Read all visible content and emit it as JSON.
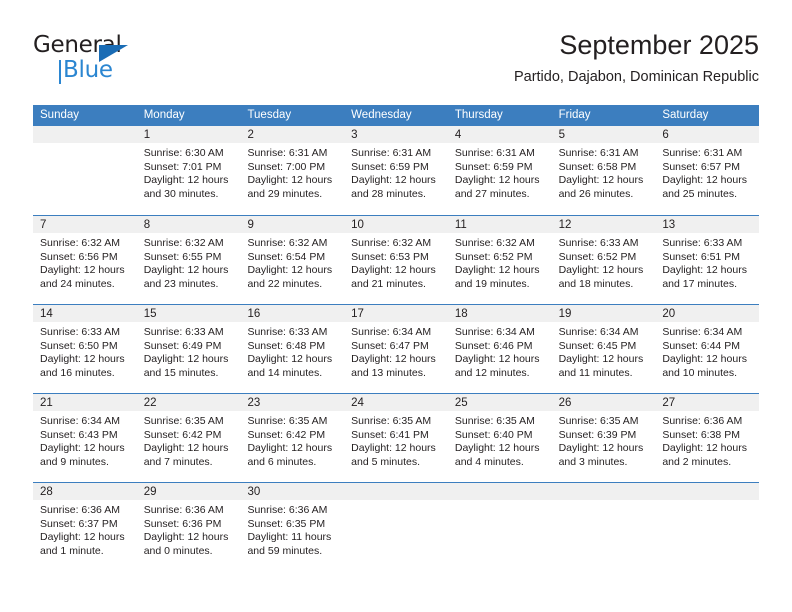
{
  "brand": {
    "name_part1": "General",
    "name_part2": "Blue",
    "accent_color": "#2b86d1",
    "triangle_color": "#1a6cb5"
  },
  "header": {
    "title": "September 2025",
    "subtitle": "Partido, Dajabon, Dominican Republic"
  },
  "calendar": {
    "header_color": "#3c7ebf",
    "daynum_band_color": "#f0f0f0",
    "weekdays": [
      "Sunday",
      "Monday",
      "Tuesday",
      "Wednesday",
      "Thursday",
      "Friday",
      "Saturday"
    ],
    "weeks": [
      [
        {
          "day": "",
          "lines": []
        },
        {
          "day": "1",
          "lines": [
            "Sunrise: 6:30 AM",
            "Sunset: 7:01 PM",
            "Daylight: 12 hours",
            "and 30 minutes."
          ]
        },
        {
          "day": "2",
          "lines": [
            "Sunrise: 6:31 AM",
            "Sunset: 7:00 PM",
            "Daylight: 12 hours",
            "and 29 minutes."
          ]
        },
        {
          "day": "3",
          "lines": [
            "Sunrise: 6:31 AM",
            "Sunset: 6:59 PM",
            "Daylight: 12 hours",
            "and 28 minutes."
          ]
        },
        {
          "day": "4",
          "lines": [
            "Sunrise: 6:31 AM",
            "Sunset: 6:59 PM",
            "Daylight: 12 hours",
            "and 27 minutes."
          ]
        },
        {
          "day": "5",
          "lines": [
            "Sunrise: 6:31 AM",
            "Sunset: 6:58 PM",
            "Daylight: 12 hours",
            "and 26 minutes."
          ]
        },
        {
          "day": "6",
          "lines": [
            "Sunrise: 6:31 AM",
            "Sunset: 6:57 PM",
            "Daylight: 12 hours",
            "and 25 minutes."
          ]
        }
      ],
      [
        {
          "day": "7",
          "lines": [
            "Sunrise: 6:32 AM",
            "Sunset: 6:56 PM",
            "Daylight: 12 hours",
            "and 24 minutes."
          ]
        },
        {
          "day": "8",
          "lines": [
            "Sunrise: 6:32 AM",
            "Sunset: 6:55 PM",
            "Daylight: 12 hours",
            "and 23 minutes."
          ]
        },
        {
          "day": "9",
          "lines": [
            "Sunrise: 6:32 AM",
            "Sunset: 6:54 PM",
            "Daylight: 12 hours",
            "and 22 minutes."
          ]
        },
        {
          "day": "10",
          "lines": [
            "Sunrise: 6:32 AM",
            "Sunset: 6:53 PM",
            "Daylight: 12 hours",
            "and 21 minutes."
          ]
        },
        {
          "day": "11",
          "lines": [
            "Sunrise: 6:32 AM",
            "Sunset: 6:52 PM",
            "Daylight: 12 hours",
            "and 19 minutes."
          ]
        },
        {
          "day": "12",
          "lines": [
            "Sunrise: 6:33 AM",
            "Sunset: 6:52 PM",
            "Daylight: 12 hours",
            "and 18 minutes."
          ]
        },
        {
          "day": "13",
          "lines": [
            "Sunrise: 6:33 AM",
            "Sunset: 6:51 PM",
            "Daylight: 12 hours",
            "and 17 minutes."
          ]
        }
      ],
      [
        {
          "day": "14",
          "lines": [
            "Sunrise: 6:33 AM",
            "Sunset: 6:50 PM",
            "Daylight: 12 hours",
            "and 16 minutes."
          ]
        },
        {
          "day": "15",
          "lines": [
            "Sunrise: 6:33 AM",
            "Sunset: 6:49 PM",
            "Daylight: 12 hours",
            "and 15 minutes."
          ]
        },
        {
          "day": "16",
          "lines": [
            "Sunrise: 6:33 AM",
            "Sunset: 6:48 PM",
            "Daylight: 12 hours",
            "and 14 minutes."
          ]
        },
        {
          "day": "17",
          "lines": [
            "Sunrise: 6:34 AM",
            "Sunset: 6:47 PM",
            "Daylight: 12 hours",
            "and 13 minutes."
          ]
        },
        {
          "day": "18",
          "lines": [
            "Sunrise: 6:34 AM",
            "Sunset: 6:46 PM",
            "Daylight: 12 hours",
            "and 12 minutes."
          ]
        },
        {
          "day": "19",
          "lines": [
            "Sunrise: 6:34 AM",
            "Sunset: 6:45 PM",
            "Daylight: 12 hours",
            "and 11 minutes."
          ]
        },
        {
          "day": "20",
          "lines": [
            "Sunrise: 6:34 AM",
            "Sunset: 6:44 PM",
            "Daylight: 12 hours",
            "and 10 minutes."
          ]
        }
      ],
      [
        {
          "day": "21",
          "lines": [
            "Sunrise: 6:34 AM",
            "Sunset: 6:43 PM",
            "Daylight: 12 hours",
            "and 9 minutes."
          ]
        },
        {
          "day": "22",
          "lines": [
            "Sunrise: 6:35 AM",
            "Sunset: 6:42 PM",
            "Daylight: 12 hours",
            "and 7 minutes."
          ]
        },
        {
          "day": "23",
          "lines": [
            "Sunrise: 6:35 AM",
            "Sunset: 6:42 PM",
            "Daylight: 12 hours",
            "and 6 minutes."
          ]
        },
        {
          "day": "24",
          "lines": [
            "Sunrise: 6:35 AM",
            "Sunset: 6:41 PM",
            "Daylight: 12 hours",
            "and 5 minutes."
          ]
        },
        {
          "day": "25",
          "lines": [
            "Sunrise: 6:35 AM",
            "Sunset: 6:40 PM",
            "Daylight: 12 hours",
            "and 4 minutes."
          ]
        },
        {
          "day": "26",
          "lines": [
            "Sunrise: 6:35 AM",
            "Sunset: 6:39 PM",
            "Daylight: 12 hours",
            "and 3 minutes."
          ]
        },
        {
          "day": "27",
          "lines": [
            "Sunrise: 6:36 AM",
            "Sunset: 6:38 PM",
            "Daylight: 12 hours",
            "and 2 minutes."
          ]
        }
      ],
      [
        {
          "day": "28",
          "lines": [
            "Sunrise: 6:36 AM",
            "Sunset: 6:37 PM",
            "Daylight: 12 hours",
            "and 1 minute."
          ]
        },
        {
          "day": "29",
          "lines": [
            "Sunrise: 6:36 AM",
            "Sunset: 6:36 PM",
            "Daylight: 12 hours",
            "and 0 minutes."
          ]
        },
        {
          "day": "30",
          "lines": [
            "Sunrise: 6:36 AM",
            "Sunset: 6:35 PM",
            "Daylight: 11 hours",
            "and 59 minutes."
          ]
        },
        {
          "day": "",
          "lines": []
        },
        {
          "day": "",
          "lines": []
        },
        {
          "day": "",
          "lines": []
        },
        {
          "day": "",
          "lines": []
        }
      ]
    ]
  }
}
